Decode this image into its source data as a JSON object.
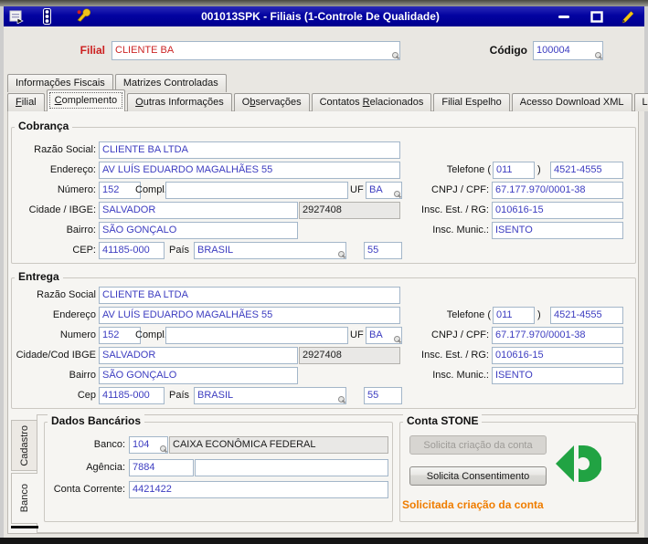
{
  "window": {
    "title": "001013SPK - Filiais (1-Controle De Qualidade)",
    "titlebar_color": "#0202a0",
    "icons_left": [
      "form-window-icon",
      "traffic-light-icon",
      "wrench-icon"
    ],
    "controls": [
      "minimize",
      "maximize",
      "edit-pencil"
    ]
  },
  "header": {
    "filial_label": "Filial",
    "filial_value": "CLIENTE BA",
    "codigo_label": "Código",
    "codigo_value": "100004",
    "filial_label_color": "#cc1f1f"
  },
  "tabs_top": [
    {
      "label": "Informações Fiscais"
    },
    {
      "label": "Matrizes Controladas"
    }
  ],
  "tabs_main": [
    {
      "label": "Filial",
      "accessKey": "F",
      "active": false
    },
    {
      "label": "Complemento",
      "accessKey": "C",
      "active": true
    },
    {
      "label": "Outras Informações",
      "accessKey": "O",
      "active": false
    },
    {
      "label": "Observações",
      "accessKey": "b",
      "active": false
    },
    {
      "label": "Contatos Relacionados",
      "accessKey": "R",
      "active": false
    },
    {
      "label": "Filial Espelho",
      "active": false
    },
    {
      "label": "Acesso Download XML",
      "active": false
    },
    {
      "label": "Log",
      "active": false
    }
  ],
  "cobranca": {
    "title": "Cobrança",
    "razao_social_label": "Razão Social:",
    "razao_social": "CLIENTE BA LTDA",
    "endereco_label": "Endereço:",
    "endereco": "AV LUÍS EDUARDO MAGALHÃES 55",
    "numero_label": "Número:",
    "numero": "152",
    "compl_label": "Compl.",
    "compl": "",
    "uf_label": "UF",
    "uf": "BA",
    "cidade_label": "Cidade / IBGE:",
    "cidade": "SALVADOR",
    "ibge": "2927408",
    "bairro_label": "Bairro:",
    "bairro": "SÃO GONÇALO",
    "cep_label": "CEP:",
    "cep": "41185-000",
    "pais_label": "País",
    "pais": "BRASIL",
    "pais_cod": "55",
    "telefone_label": "Telefone (",
    "telefone_close": ")",
    "ddd": "011",
    "telefone": "4521-4555",
    "cnpj_label": "CNPJ / CPF:",
    "cnpj": "67.177.970/0001-38",
    "insc_est_label": "Insc. Est. / RG:",
    "insc_est": "010616-15",
    "insc_mun_label": "Insc. Munic.:",
    "insc_mun": "ISENTO"
  },
  "entrega": {
    "title": "Entrega",
    "razao_social_label": "Razão Social",
    "razao_social": "CLIENTE BA LTDA",
    "endereco_label": "Endereço",
    "endereco": "AV LUÍS EDUARDO MAGALHÃES 55",
    "numero_label": "Numero",
    "numero": "152",
    "compl_label": "Compl.",
    "compl": "",
    "uf_label": "UF",
    "uf": "BA",
    "cidade_label": "Cidade/Cod IBGE",
    "cidade": "SALVADOR",
    "ibge": "2927408",
    "bairro_label": "Bairro",
    "bairro": "SÃO GONÇALO",
    "cep_label": "Cep",
    "cep": "41185-000",
    "pais_label": "País",
    "pais": "BRASIL",
    "pais_cod": "55",
    "telefone_label": "Telefone (",
    "telefone_close": ")",
    "ddd": "011",
    "telefone": "4521-4555",
    "cnpj_label": "CNPJ / CPF:",
    "cnpj": "67.177.970/0001-38",
    "insc_est_label": "Insc. Est. / RG:",
    "insc_est": "010616-15",
    "insc_mun_label": "Insc. Munic.:",
    "insc_mun": "ISENTO"
  },
  "side_tabs": [
    {
      "label": "Cadastro",
      "active": false
    },
    {
      "label": "Banco",
      "active": true
    }
  ],
  "dados_bancarios": {
    "title": "Dados Bancários",
    "banco_label": "Banco:",
    "banco_cod": "104",
    "banco_nome": "CAIXA ECONÔMICA FEDERAL",
    "agencia_label": "Agência:",
    "agencia": "7884",
    "agencia_digito": "",
    "conta_label": "Conta Corrente:",
    "conta": "4421422"
  },
  "conta_stone": {
    "title": "Conta STONE",
    "btn_criacao": "Solicita criação da conta",
    "btn_criacao_enabled": false,
    "btn_consentimento": "Solicita Consentimento",
    "status": "Solicitada criação da conta",
    "status_color": "#ef7d00",
    "logo_color": "#21a343"
  },
  "colors": {
    "field_text_blue": "#3c3cc0",
    "header_red": "#cc1f1f",
    "readonly_bg": "#e9e8e6",
    "page_bg": "#f6f5f2"
  }
}
